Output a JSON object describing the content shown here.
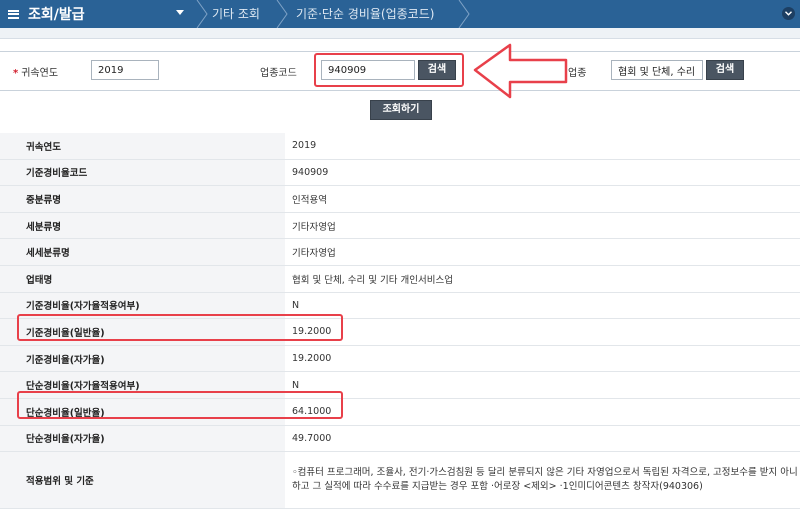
{
  "topbar": {
    "menu_title": "조회/발급",
    "breadcrumbs": [
      "기타 조회",
      "기준·단순 경비율(업종코드)"
    ]
  },
  "search": {
    "year_label": "귀속연도",
    "year_value": "2019",
    "code_label": "업종코드",
    "code_value": "940909",
    "search_button": "검색",
    "industry_label": "업종",
    "industry_value": "협회 및 단체, 수리",
    "search_button2": "검색",
    "query_button": "조회하기"
  },
  "result": {
    "rows": [
      {
        "label": "귀속연도",
        "value": "2019"
      },
      {
        "label": "기준경비율코드",
        "value": "940909"
      },
      {
        "label": "중분류명",
        "value": "인적용역"
      },
      {
        "label": "세분류명",
        "value": "기타자영업"
      },
      {
        "label": "세세분류명",
        "value": "기타자영업"
      },
      {
        "label": "업태명",
        "value": "협회 및 단체, 수리 및 기타 개인서비스업"
      },
      {
        "label": "기준경비율(자가율적용여부)",
        "value": "N"
      },
      {
        "label": "기준경비율(일반율)",
        "value": "19.2000"
      },
      {
        "label": "기준경비율(자가율)",
        "value": "19.2000"
      },
      {
        "label": "단순경비율(자가율적용여부)",
        "value": "N"
      },
      {
        "label": "단순경비율(일반율)",
        "value": "64.1000"
      },
      {
        "label": "단순경비율(자가율)",
        "value": "49.7000"
      },
      {
        "label": "적용범위 및 기준",
        "value": "◦컴퓨터 프로그래머, 조율사, 전기·가스검침원 등 달리 분류되지 않은 기타 자영업으로서 독립된 자격으로, 고정보수를 받지 아니하고 그 실적에 따라 수수료를 지급받는 경우 포함 ·어로장 <제외> ·1인미디어콘텐츠 창작자(940306)"
      }
    ]
  },
  "colors": {
    "topbar": "#2a6296",
    "highlight": "#e8404a",
    "button": "#4a5562"
  }
}
